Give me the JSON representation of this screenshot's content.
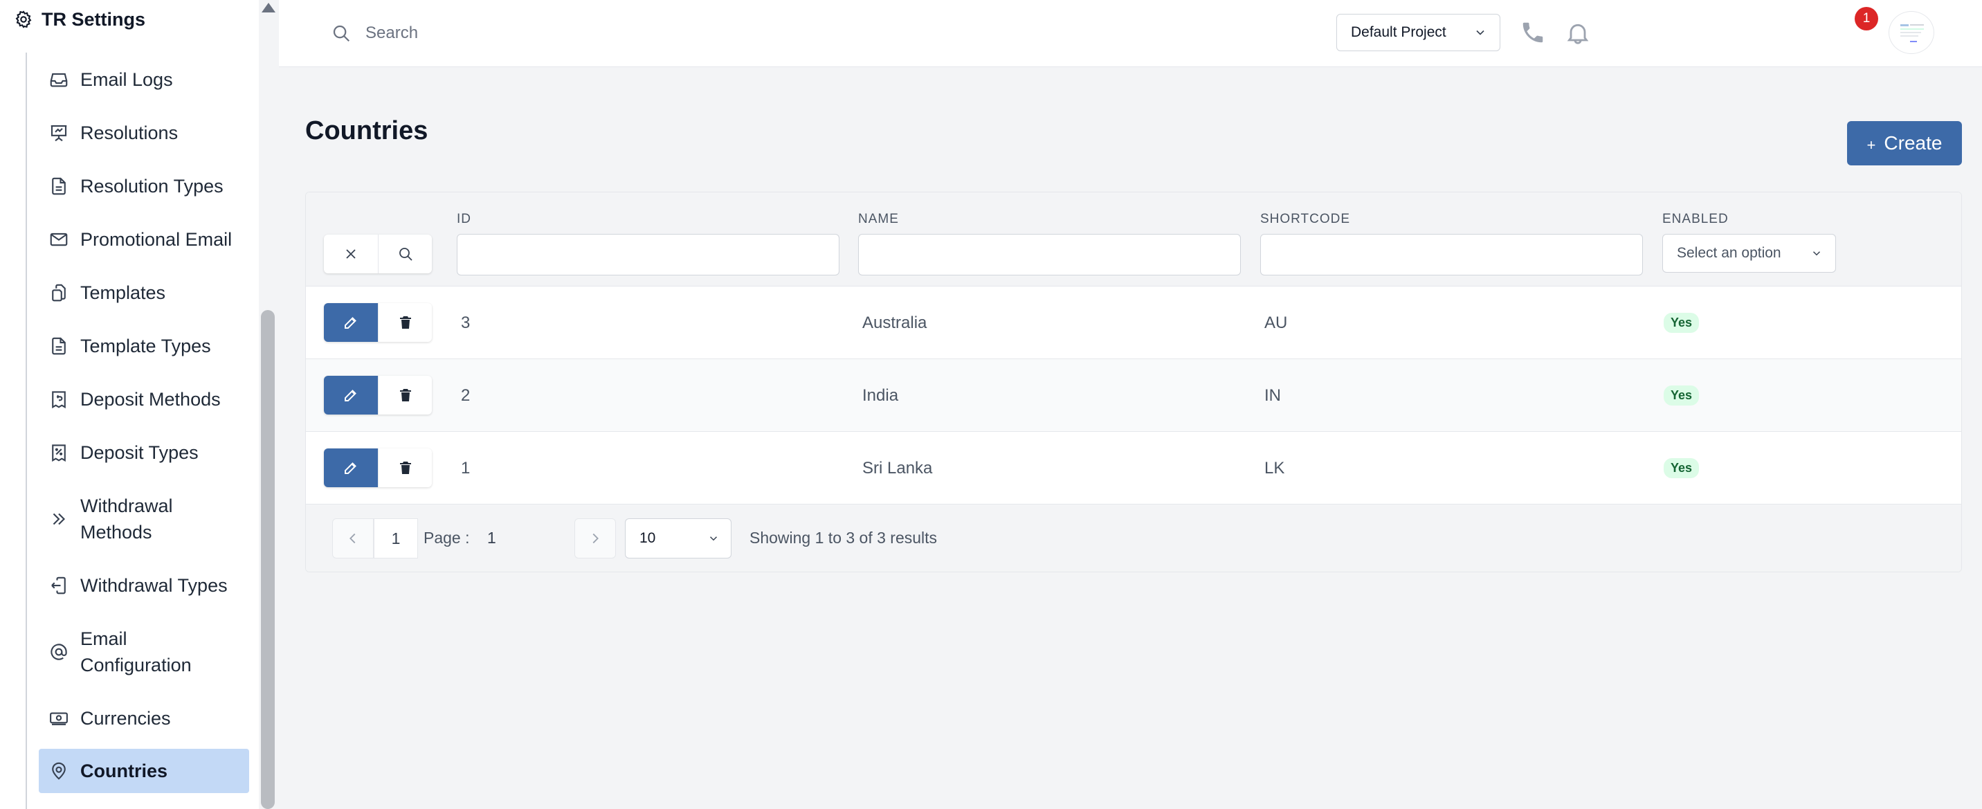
{
  "sidebar": {
    "title": "TR Settings",
    "items": [
      {
        "label": "Email Logs",
        "icon": "inbox-icon"
      },
      {
        "label": "Resolutions",
        "icon": "presentation-chart-icon"
      },
      {
        "label": "Resolution Types",
        "icon": "document-icon"
      },
      {
        "label": "Promotional Email",
        "icon": "envelope-icon"
      },
      {
        "label": "Templates",
        "icon": "documents-icon"
      },
      {
        "label": "Template Types",
        "icon": "document-icon"
      },
      {
        "label": "Deposit Methods",
        "icon": "receipt-refund-icon"
      },
      {
        "label": "Deposit Types",
        "icon": "receipt-percent-icon"
      },
      {
        "label": "Withdrawal Methods",
        "icon": "chevron-double-right-icon"
      },
      {
        "label": "Withdrawal Types",
        "icon": "arrow-left-on-rectangle-icon"
      },
      {
        "label": "Email Configuration",
        "icon": "at-symbol-icon"
      },
      {
        "label": "Currencies",
        "icon": "banknotes-icon"
      },
      {
        "label": "Countries",
        "icon": "map-pin-icon",
        "active": true
      }
    ]
  },
  "topbar": {
    "search_placeholder": "Search",
    "project": "Default Project",
    "notification_count": "1"
  },
  "page": {
    "title": "Countries",
    "create_label": "Create"
  },
  "table": {
    "columns": {
      "id": "ID",
      "name": "NAME",
      "shortcode": "SHORTCODE",
      "enabled": "ENABLED"
    },
    "enabled_filter_placeholder": "Select an option",
    "rows": [
      {
        "id": "3",
        "name": "Australia",
        "shortcode": "AU",
        "enabled": "Yes"
      },
      {
        "id": "2",
        "name": "India",
        "shortcode": "IN",
        "enabled": "Yes"
      },
      {
        "id": "1",
        "name": "Sri Lanka",
        "shortcode": "LK",
        "enabled": "Yes"
      }
    ]
  },
  "pagination": {
    "page_button": "1",
    "page_label": "Page :",
    "current_page": "1",
    "per_page": "10",
    "summary": "Showing 1 to 3 of 3 results"
  },
  "colors": {
    "primary": "#3d6aa8",
    "active_nav": "#c3d9f6",
    "badge_bg": "#dcfce7",
    "badge_text": "#166534",
    "notification": "#dc2626"
  }
}
